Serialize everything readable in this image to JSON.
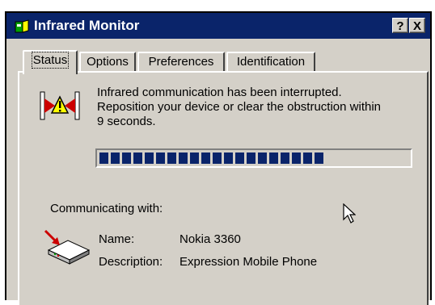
{
  "window": {
    "title": "Infrared Monitor",
    "help_button": "?",
    "close_button": "X"
  },
  "tabs": [
    {
      "label": "Status",
      "active": true
    },
    {
      "label": "Options",
      "active": false
    },
    {
      "label": "Preferences",
      "active": false
    },
    {
      "label": "Identification",
      "active": false
    }
  ],
  "status": {
    "message_line1": "Infrared communication has been interrupted.",
    "message_line2": "Reposition your device or clear the obstruction within",
    "message_line3": "9 seconds.",
    "progress": 0.72,
    "communicating_label": "Communicating with:",
    "name_label": "Name:",
    "name_value": "Nokia 3360",
    "description_label": "Description:",
    "description_value": "Expression Mobile Phone"
  },
  "icons": {
    "title": "infrared-monitor-icon",
    "warning": "infrared-warning-icon",
    "device": "infrared-device-icon",
    "cursor": "mouse-pointer-icon"
  },
  "colors": {
    "titlebar": "#0a246a",
    "face": "#d4d0c8",
    "progress": "#0a246a",
    "warning_yellow": "#ffff00",
    "alert_red": "#cc0000"
  }
}
